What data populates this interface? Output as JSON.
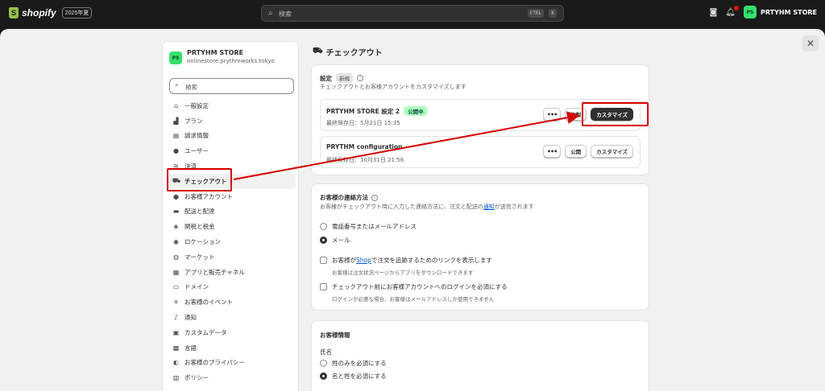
{
  "topbar": {
    "logo_text": "shopify",
    "year_badge": "2025年夏",
    "search_placeholder": "検索",
    "kbd_ctrl": "CTRL",
    "kbd_k": "K",
    "store_initials": "PS",
    "store_name": "PRTYHM STORE"
  },
  "sidebar": {
    "store_initials": "PS",
    "store_name": "PRTYHM STORE",
    "domain": "onlinestore.prythmworks.tokyo",
    "search_placeholder": "検索",
    "items": [
      {
        "label": "一般設定",
        "icon": "store-icon"
      },
      {
        "label": "プラン",
        "icon": "chart-icon"
      },
      {
        "label": "請求情報",
        "icon": "receipt-icon"
      },
      {
        "label": "ユーザー",
        "icon": "users-icon"
      },
      {
        "label": "決済",
        "icon": "payment-icon"
      },
      {
        "label": "チェックアウト",
        "icon": "cart-icon"
      },
      {
        "label": "お客様アカウント",
        "icon": "person-icon"
      },
      {
        "label": "配送と配達",
        "icon": "truck-icon"
      },
      {
        "label": "関税と税金",
        "icon": "tax-icon"
      },
      {
        "label": "ロケーション",
        "icon": "location-icon"
      },
      {
        "label": "マーケット",
        "icon": "globe-icon"
      },
      {
        "label": "アプリと販売チャネル",
        "icon": "apps-icon"
      },
      {
        "label": "ドメイン",
        "icon": "domain-icon"
      },
      {
        "label": "お客様のイベント",
        "icon": "sparkle-icon"
      },
      {
        "label": "通知",
        "icon": "bell-icon"
      },
      {
        "label": "カスタムデータ",
        "icon": "database-icon"
      },
      {
        "label": "言語",
        "icon": "language-icon"
      },
      {
        "label": "お客様のプライバシー",
        "icon": "lock-icon"
      },
      {
        "label": "ポリシー",
        "icon": "policy-icon"
      }
    ]
  },
  "page": {
    "title": "チェックアウト"
  },
  "settings_card": {
    "title": "設定",
    "new_badge": "新規",
    "description": "チェックアウトとお客様アカウントをカスタマイズします",
    "configs": [
      {
        "name": "PRTYHM STORE 設定 2",
        "badge": "公開中",
        "saved": "最終保存日：5月21日 15:35",
        "copy_label": "複製",
        "customize_label": "カスタマイズ"
      },
      {
        "name": "PRYTHM configuration",
        "saved": "最終保存日：10月31日 21:56",
        "publish_label": "公開",
        "customize_label": "カスタマイズ"
      }
    ]
  },
  "contact_card": {
    "title": "お客様の連絡方法",
    "description_pre": "お客様がチェックアウト時に入力した連絡方法に、注文と配送の",
    "description_link": "通知",
    "description_post": "が送信されます",
    "radio_phone_email": "電話番号またはメールアドレス",
    "radio_email": "メール",
    "check1_pre": "お客様が",
    "check1_link": "Shop",
    "check1_post": "で注文を追跡するためのリンクを表示します",
    "check1_desc": "お客様は注文状況ページからアプリをダウンロードできます",
    "check2_label": "チェックアウト前にお客様アカウントへのログインを必須にする",
    "check2_desc": "ログインが必要な場合、お客様はメールアドレスしか使用できません"
  },
  "customer_info_card": {
    "title": "お客様情報",
    "name_label": "氏名",
    "radio_last_only": "姓のみを必須にする",
    "radio_both": "名と姓を必須にする"
  },
  "colors": {
    "highlight": "#d40000",
    "accent_green": "#36e06c"
  }
}
